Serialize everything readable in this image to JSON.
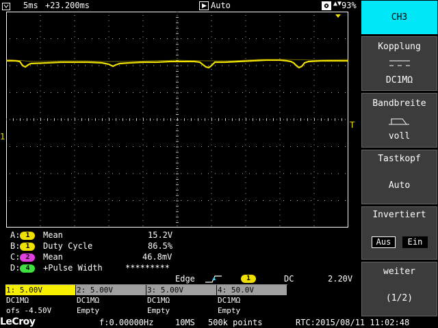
{
  "status_bar": {
    "timebase": "5ms",
    "delay": "+23.200ms",
    "trigger_mode": "Auto",
    "battery": "93%"
  },
  "screen": {
    "channel1_marker": "1",
    "trigger_level_marker": "T",
    "trace_color": "#f0e000"
  },
  "measurements": [
    {
      "slot": "A:",
      "badge": "1",
      "badge_color": "#f0e000",
      "name": "Mean",
      "value": "15.2V"
    },
    {
      "slot": "B:",
      "badge": "1",
      "badge_color": "#f0e000",
      "name": "Duty Cycle",
      "value": "86.5%"
    },
    {
      "slot": "C:",
      "badge": "2",
      "badge_color": "#e040e0",
      "name": "Mean",
      "value": "46.8mV"
    },
    {
      "slot": "D:",
      "badge": "4",
      "badge_color": "#40e040",
      "name": "+Pulse Width",
      "value": "*********"
    }
  ],
  "trigger": {
    "type": "Edge",
    "source": "1",
    "coupling": "DC",
    "level": "2.20V"
  },
  "channels": [
    {
      "header": "1: 5.00V",
      "coupling": "DC1MΩ",
      "extra": "ofs   -4.50V",
      "active": true
    },
    {
      "header": "2: 5.00V",
      "coupling": "DC1MΩ",
      "extra": "Empty",
      "active": false
    },
    {
      "header": "3: 5.00V",
      "coupling": "DC1MΩ",
      "extra": "Empty",
      "active": false
    },
    {
      "header": "4: 50.0V",
      "coupling": "DC1MΩ",
      "extra": "Empty",
      "active": false
    }
  ],
  "bottom_bar": {
    "brand": "LeCroy",
    "frequency": "f:0.00000Hz",
    "sample_rate": "10MS",
    "points": "500k points",
    "rtc": "RTC:2015/08/11 11:02:48"
  },
  "menu": {
    "title": "CH3",
    "kopplung_label": "Kopplung",
    "kopplung_value": "DC1MΩ",
    "bandbreite_label": "Bandbreite",
    "bandbreite_value": "voll",
    "tastkopf_label": "Tastkopf",
    "tastkopf_value": "Auto",
    "invertiert_label": "Invertiert",
    "invertiert_off": "Aus",
    "invertiert_on": "Ein",
    "weiter_label": "weiter",
    "page": "(1/2)"
  }
}
